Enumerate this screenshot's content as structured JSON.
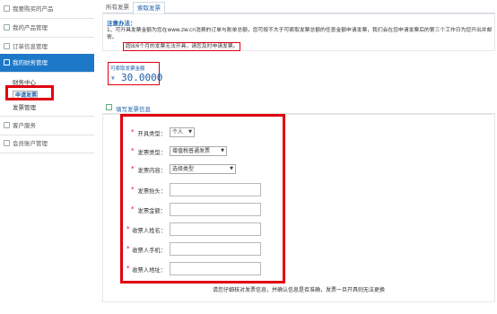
{
  "sidebar": {
    "items": [
      {
        "label": "我要购买的产品"
      },
      {
        "label": "我的产品管理"
      },
      {
        "label": "订单信息管理"
      },
      {
        "label": "我的财务管理"
      },
      {
        "label": "客户服务"
      },
      {
        "label": "会员账户管理"
      }
    ],
    "sub_items": [
      {
        "label": "财务中心"
      },
      {
        "label": "申请发票"
      },
      {
        "label": "发票管理"
      }
    ]
  },
  "tabs": [
    {
      "label": "所有发票"
    },
    {
      "label": "索取发票"
    }
  ],
  "notice": {
    "title": "注意办法：",
    "line1": "1、可开具发票金额为您在www.zw.cn消费的订单与账单总额，您可按不大于可索取发票总额的任意金额申请发票，我们会在您申请发票后的第三个工作日为您开出并邮寄。",
    "line2": "超出6个月的发票无法开具，请您及时申请发票。"
  },
  "amount": {
    "label": "可索取发票金额",
    "currency": "¥",
    "value": "30.0000"
  },
  "form": {
    "heading": "填写发票信息",
    "fields": {
      "type": {
        "label": "开具类型：",
        "value": "个人"
      },
      "kind": {
        "label": "发票类型：",
        "value": "增值税普通发票"
      },
      "content": {
        "label": "发票内容：",
        "value": "选择类型"
      },
      "header": {
        "label": "发票抬头："
      },
      "amount": {
        "label": "发票金额："
      },
      "name": {
        "label": "收票人姓名："
      },
      "phone": {
        "label": "收票人手机："
      },
      "address": {
        "label": "收票人地址："
      }
    },
    "required_mark": "*",
    "footer": "请您仔细核对发票信息，并确认信息是否准确，发票一旦开具则无法更换"
  },
  "icons": {
    "dropdown": "caret-down-icon"
  },
  "colors": {
    "accent": "#1e78c8",
    "highlight": "#e00012"
  }
}
